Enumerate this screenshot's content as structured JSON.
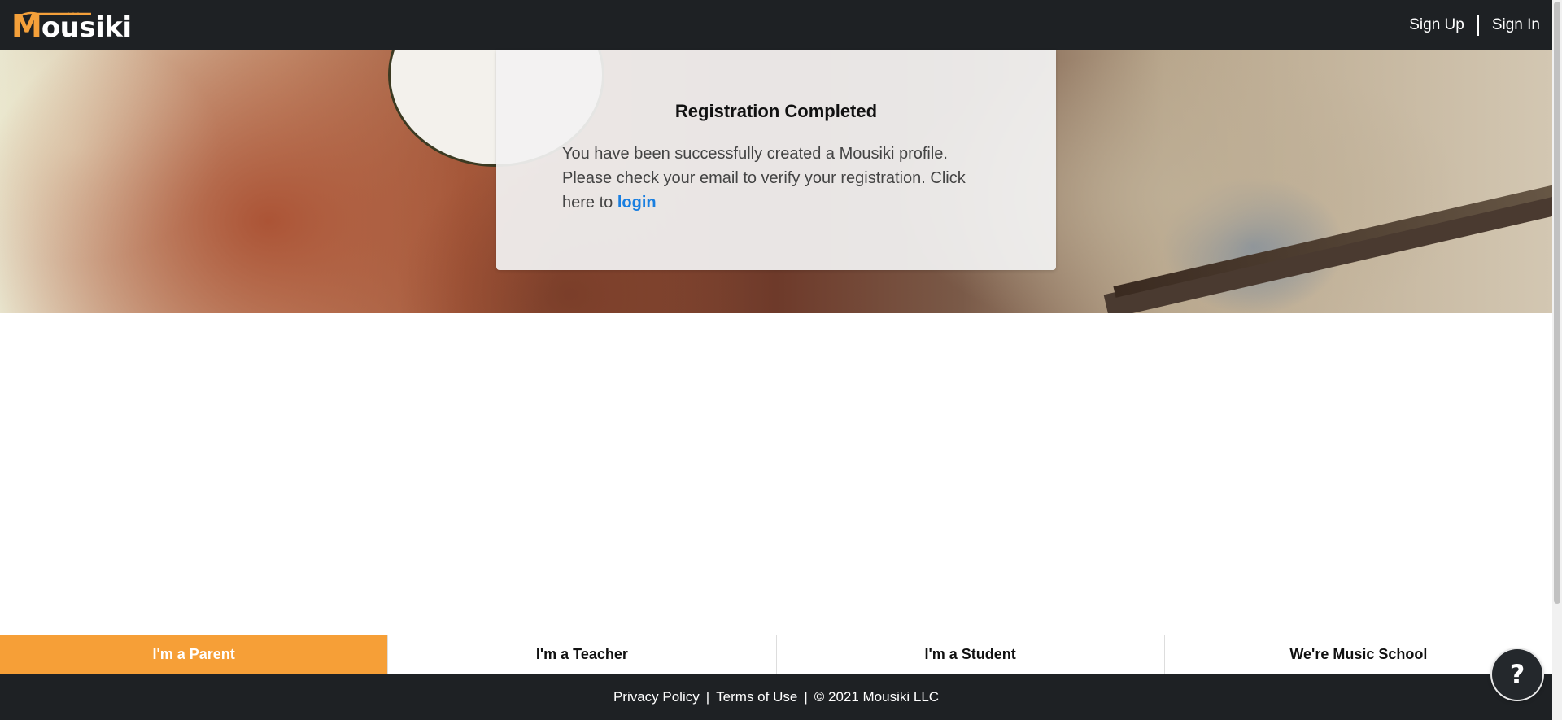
{
  "header": {
    "logo_first": "M",
    "logo_rest": "ousiki",
    "sign_up": "Sign Up",
    "sign_in": "Sign In"
  },
  "card": {
    "title": "Registration Completed",
    "body_text": "You have been successfully created a Mousiki profile. Please check your email to verify your registration. Click here to ",
    "login_link": "login"
  },
  "roles": [
    {
      "label": "I'm a Parent",
      "active": true
    },
    {
      "label": "I'm a Teacher",
      "active": false
    },
    {
      "label": "I'm a Student",
      "active": false
    },
    {
      "label": "We're Music School",
      "active": false
    }
  ],
  "footer": {
    "privacy": "Privacy Policy",
    "sep": "|",
    "terms": "Terms of Use",
    "copyright": "© 2021 Mousiki LLC"
  },
  "help": {
    "label": "?"
  },
  "colors": {
    "accent": "#f69f37",
    "dark": "#1e2124",
    "link": "#1a7fe0"
  }
}
